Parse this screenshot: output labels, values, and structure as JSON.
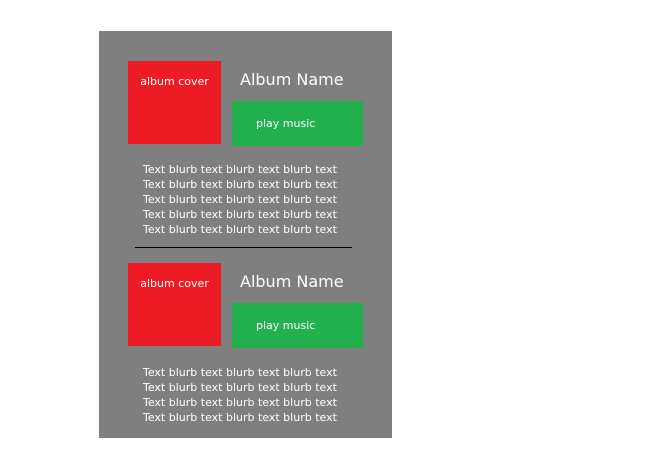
{
  "entries": [
    {
      "cover_label": "album cover",
      "album_name": "Album Name",
      "play_label": "play music",
      "blurb_lines": [
        "Text blurb text blurb text blurb text",
        "Text blurb text blurb text blurb text",
        "Text blurb text blurb text blurb text",
        "Text blurb text blurb text blurb text",
        "Text blurb text blurb text blurb text"
      ]
    },
    {
      "cover_label": "album cover",
      "album_name": "Album Name",
      "play_label": "play music",
      "blurb_lines": [
        "Text blurb text blurb text blurb text",
        "Text blurb text blurb text blurb text",
        "Text blurb text blurb text blurb text",
        "Text blurb text blurb text blurb text"
      ]
    }
  ],
  "colors": {
    "panel_background": "#7f7f7f",
    "cover": "#ed1c24",
    "play_button": "#22b14c",
    "text": "#ffffff",
    "divider": "#000000"
  }
}
